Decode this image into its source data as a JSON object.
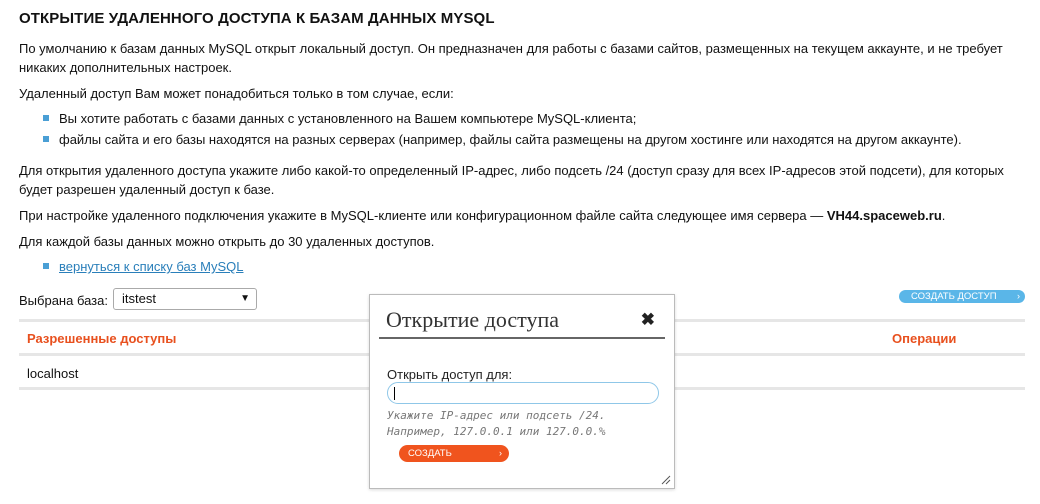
{
  "title": "ОТКРЫТИЕ УДАЛЕННОГО ДОСТУПА К БАЗАМ ДАННЫХ MYSQL",
  "intro": "По умолчанию к базам данных MySQL открыт локальный доступ. Он предназначен для работы с базами сайтов, размещенных на текущем аккаунте, и не требует никаких дополнительных настроек.",
  "remote_need": "Удаленный доступ Вам может понадобиться только в том случае, если:",
  "bullets": [
    "Вы хотите работать с базами данных с установленного на Вашем компьютере MySQL-клиента;",
    "файлы сайта и его базы находятся на разных серверах (например, файлы сайта размещены на другом хостинге или находятся на другом аккаунте)."
  ],
  "ip_info": "Для открытия удаленного доступа укажите либо какой-то определенный IP-адрес, либо подсеть /24 (доступ сразу для всех IP-адресов этой подсети), для которых будет разрешен удаленный доступ к базе.",
  "server_text": "При настройке удаленного подключения укажите в MySQL-клиенте или конфигурационном файле сайта следующее имя сервера —",
  "server_name": "VH44.spaceweb.ru",
  "server_dot": ".",
  "limit_text": "Для каждой базы данных можно открыть до 30 удаленных доступов.",
  "back_link": "вернуться к списку баз MySQL",
  "db_select": {
    "label": "Выбрана база:",
    "value": "itstest"
  },
  "create_button": "СОЗДАТЬ ДОСТУП",
  "table": {
    "headers": [
      "Разрешенные доступы",
      "Операции"
    ],
    "rows": [
      [
        "localhost",
        ""
      ]
    ]
  },
  "modal": {
    "title": "Открытие доступа",
    "label": "Открыть доступ для:",
    "input_value": "",
    "hint_line1": "Укажите IP-адрес или подсеть /24.",
    "hint_line2": "Например, 127.0.0.1 или 127.0.0.%",
    "submit": "СОЗДАТЬ"
  },
  "colors": {
    "accent_blue": "#5ab6e8",
    "accent_orange": "#f0541e",
    "header_red": "#e8501e",
    "link": "#2a7fba"
  }
}
